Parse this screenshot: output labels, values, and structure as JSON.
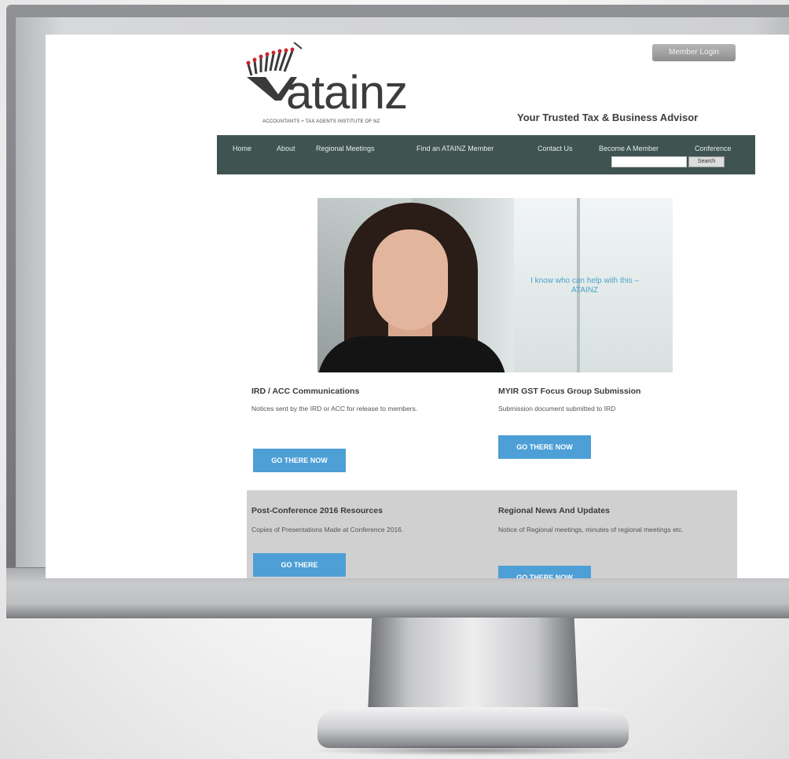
{
  "site": {
    "logo_word": "atainz",
    "logo_tagline": "ACCOUNTANTS + TAX AGENTS INSTITUTE OF NZ",
    "member_login": "Member Login",
    "tagline": "Your Trusted Tax & Business Advisor",
    "nav": {
      "items": [
        "Home",
        "About",
        "Regional Meetings",
        "Find an ATAINZ Member",
        "Contact Us",
        "Become A Member",
        "Conference"
      ],
      "search_button": "Search"
    },
    "hero_caption": "I know who can help with this – ATAINZ"
  },
  "cards": [
    {
      "title": "IRD / ACC Communications",
      "desc": "Notices sent by the IRD or ACC for release to members.",
      "button": "GO THERE NOW"
    },
    {
      "title": "MYIR GST Focus Group Submission",
      "desc": "Submission document submitted to IRD",
      "button": "GO THERE NOW"
    },
    {
      "title": "Post-Conference 2016 Resources",
      "desc": "Copies of Presentations Made at Conference 2016.",
      "button": "GO THERE"
    },
    {
      "title": "Regional News And Updates",
      "desc": "Notice of Regional meetings, minutes of regional meetings etc.",
      "button": "GO THERE NOW"
    }
  ],
  "colors": {
    "nav_bg": "#3f5451",
    "button_bg": "#4d9fd6",
    "gray_band": "#d0d0d0"
  }
}
